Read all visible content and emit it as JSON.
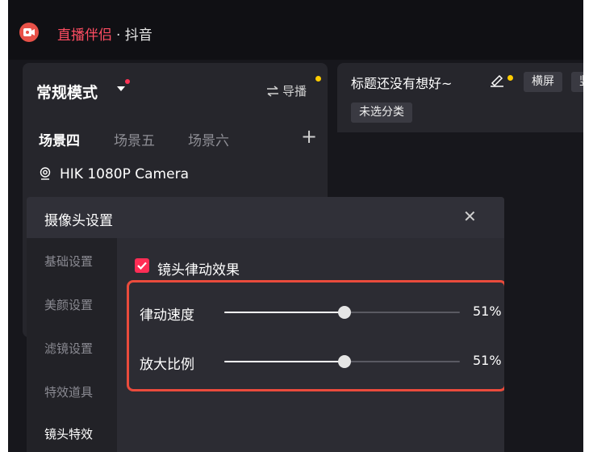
{
  "app": {
    "name": "直播伴侣",
    "separator_text": "· 抖音",
    "brand_color": "#ff4d62"
  },
  "left_panel": {
    "mode_label": "常规模式",
    "director_label": "导播",
    "scenes": [
      {
        "label": "场景四",
        "active": true
      },
      {
        "label": "场景五",
        "active": false
      },
      {
        "label": "场景六",
        "active": false
      }
    ],
    "add_icon": "plus-icon",
    "camera_source": "HIK 1080P Camera"
  },
  "right_panel": {
    "stream_title": "标题还没有想好~",
    "orientation_landscape": "横屏",
    "orientation_portrait": "竖",
    "category": "未选分类"
  },
  "dialog": {
    "title": "摄像头设置",
    "close_icon": "close-icon",
    "nav": [
      {
        "label": "基础设置",
        "active": false
      },
      {
        "label": "美颜设置",
        "active": false
      },
      {
        "label": "滤镜设置",
        "active": false
      },
      {
        "label": "特效道具",
        "active": false
      },
      {
        "label": "镜头特效",
        "active": true
      }
    ],
    "checkbox_label": "镜头律动效果",
    "checkbox_checked": true,
    "sliders": [
      {
        "label": "律动速度",
        "value": 0.51,
        "value_text": "51%"
      },
      {
        "label": "放大比例",
        "value": 0.51,
        "value_text": "51%"
      }
    ],
    "accent_color": "#ff2d55",
    "highlight_color": "#ea4b3c"
  }
}
